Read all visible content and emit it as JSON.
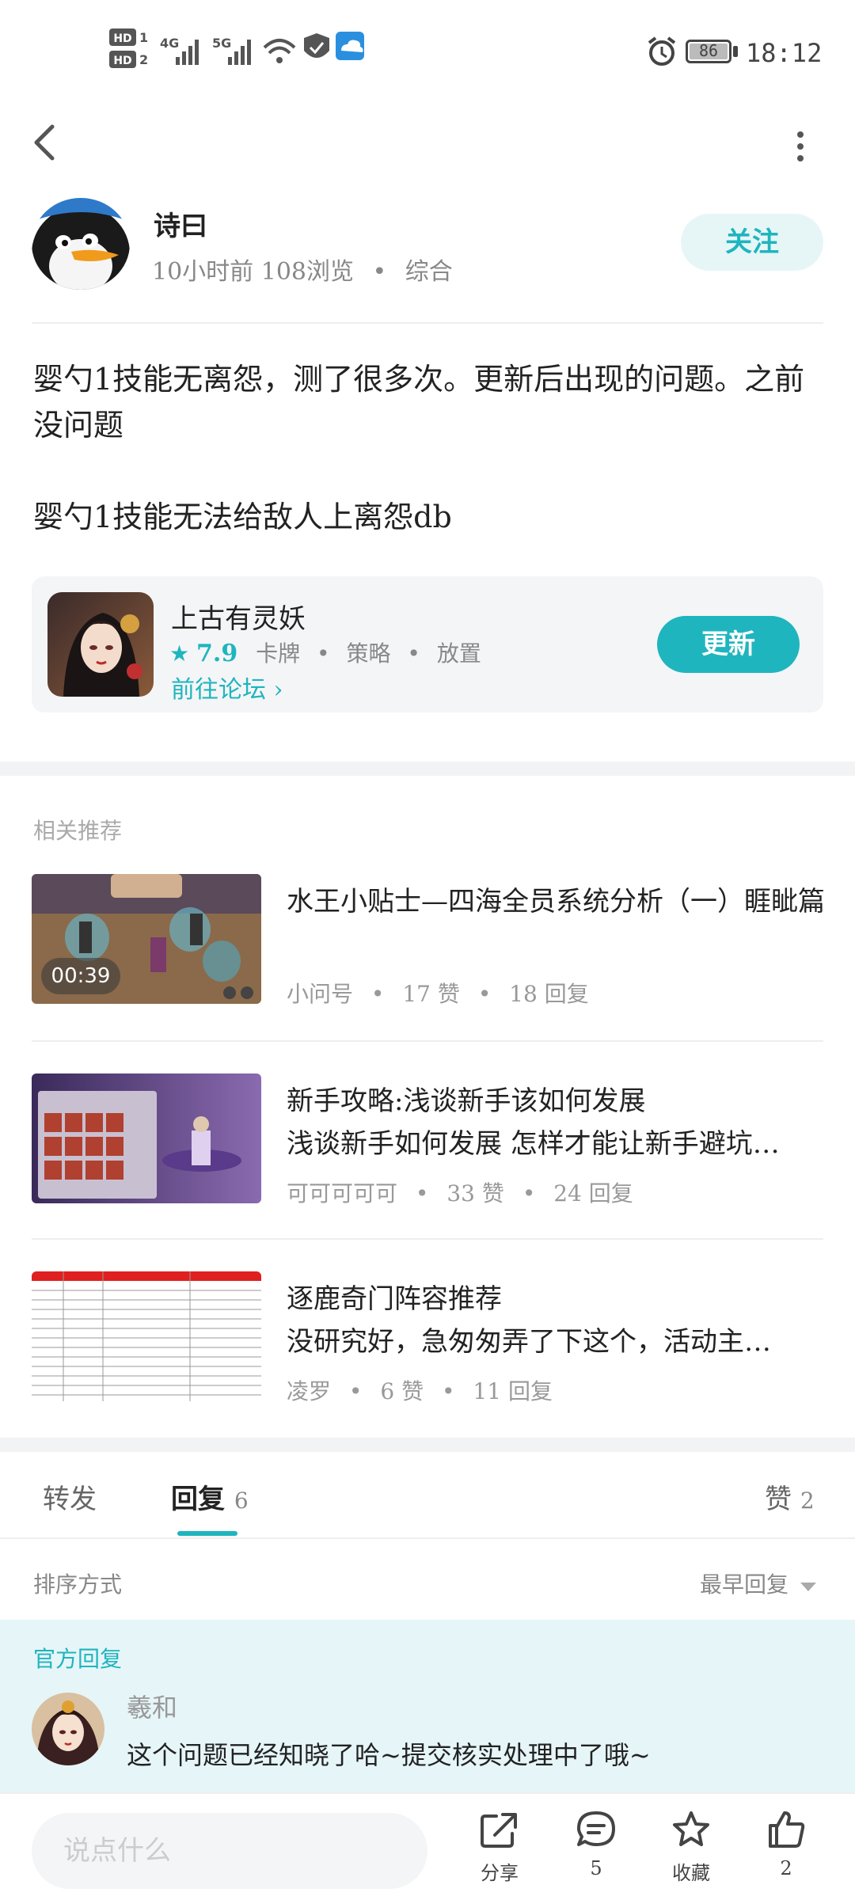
{
  "status_bar": {
    "sim1": "HD 1",
    "sim2": "HD 2",
    "net1": "4G",
    "net2": "5G",
    "battery": "86",
    "time": "18:12"
  },
  "post": {
    "author": "诗曰",
    "time": "10小时前",
    "views": "108浏览",
    "category": "综合",
    "follow_label": "关注",
    "paragraphs": [
      "婴勺1技能无离怨，测了很多次。更新后出现的问题。之前没问题",
      "婴勺1技能无法给敌人上离怨db"
    ]
  },
  "game_card": {
    "name": "上古有灵妖",
    "score": "7.9",
    "tags": [
      "卡牌",
      "策略",
      "放置"
    ],
    "forum_link": "前往论坛",
    "update_label": "更新"
  },
  "related": {
    "heading": "相关推荐",
    "items": [
      {
        "title": "水王小贴士—四海全员系统分析（一）睚眦篇",
        "author": "小问号",
        "likes": "17",
        "likes_unit": "赞",
        "replies": "18",
        "replies_unit": "回复",
        "duration": "00:39"
      },
      {
        "title": "新手攻略:浅谈新手该如何发展",
        "subtitle": "浅谈新手如何发展 怎样才能让新手避坑…",
        "author": "可可可可可",
        "likes": "33",
        "likes_unit": "赞",
        "replies": "24",
        "replies_unit": "回复"
      },
      {
        "title": "逐鹿奇门阵容推荐",
        "subtitle": "没研究好，急匆匆弄了下这个，活动主…",
        "author": "凌罗",
        "likes": "6",
        "likes_unit": "赞",
        "replies": "11",
        "replies_unit": "回复"
      }
    ]
  },
  "tabs": {
    "forward": "转发",
    "reply": "回复",
    "reply_count": "6",
    "like": "赞",
    "like_count": "2"
  },
  "sort": {
    "label": "排序方式",
    "value": "最早回复"
  },
  "official_reply": {
    "label": "官方回复",
    "author": "羲和",
    "text": "这个问题已经知晓了哈~提交核实处理中了哦~"
  },
  "bottom_bar": {
    "input_placeholder": "说点什么",
    "share": "分享",
    "comments": "5",
    "favorite": "收藏",
    "likes": "2"
  },
  "colors": {
    "accent": "#1fb5be",
    "official_bg": "#e6f5f8"
  }
}
